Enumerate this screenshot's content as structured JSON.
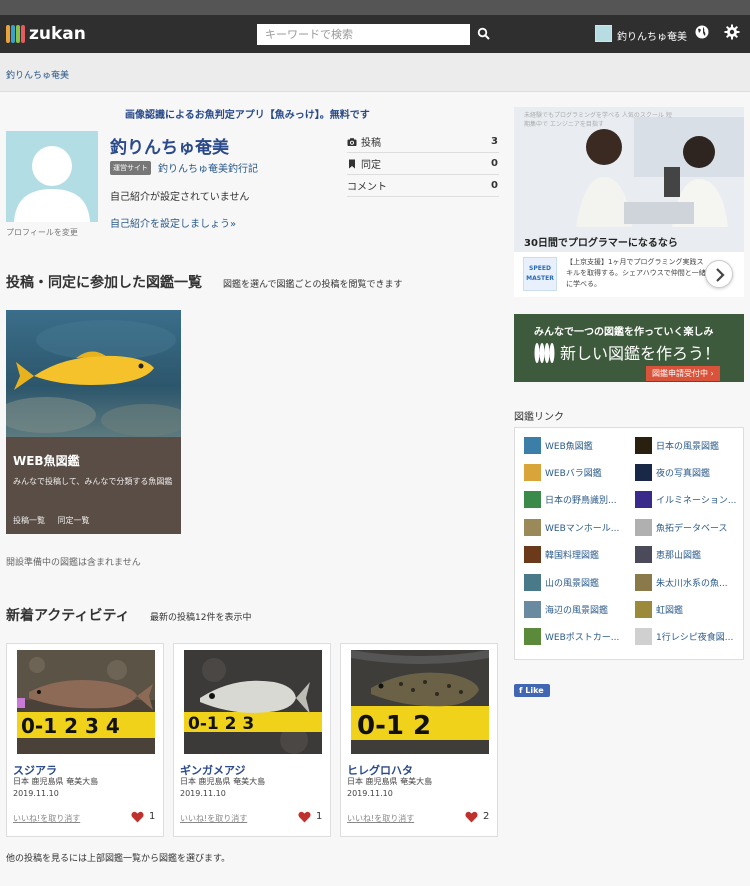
{
  "header": {
    "logo_text": "zukan",
    "search_placeholder": "キーワードで検索",
    "user_name": "釣りんちゅ奄美"
  },
  "breadcrumb": "釣りんちゅ奄美",
  "promo": "画像認識によるお魚判定アプリ【魚みっけ】。無料です",
  "profile": {
    "name": "釣りんちゅ奄美",
    "badge": "運営サイト",
    "site_link": "釣りんちゅ奄美釣行記",
    "intro": "自己紹介が設定されていません",
    "intro_link": "自己紹介を設定しましょう»",
    "change_photo": "プロフィールを変更"
  },
  "stats": [
    {
      "label": "投稿",
      "value": "3",
      "icon": "camera-icon"
    },
    {
      "label": "同定",
      "value": "0",
      "icon": "bookmark-icon"
    },
    {
      "label": "コメント",
      "value": "0",
      "icon": ""
    }
  ],
  "zukan_section": {
    "title": "投稿・同定に参加した図鑑一覧",
    "subtitle": "図鑑を選んで図鑑ごとの投稿を閲覧できます",
    "card": {
      "title": "WEB魚図鑑",
      "desc": "みんなで投稿して、みんなで分類する魚図鑑",
      "link1": "投稿一覧",
      "link2": "同定一覧"
    },
    "note": "開設準備中の図鑑は含まれません"
  },
  "activity": {
    "title": "新着アクティビティ",
    "subtitle": "最新の投稿12件を表示中",
    "items": [
      {
        "name": "スジアラ",
        "location": "日本 鹿児島県 奄美大島",
        "date": "2019.11.10",
        "like_label": "いいね!を取り消す",
        "likes": "1"
      },
      {
        "name": "ギンガメアジ",
        "location": "日本 鹿児島県 奄美大島",
        "date": "2019.11.10",
        "like_label": "いいね!を取り消す",
        "likes": "1"
      },
      {
        "name": "ヒレグロハタ",
        "location": "日本 鹿児島県 奄美大島",
        "date": "2019.11.10",
        "like_label": "いいね!を取り消す",
        "likes": "2"
      }
    ],
    "footer": "他の投稿を見るには上部図鑑一覧から図鑑を選びます。"
  },
  "ads": {
    "ad1_top": "未経験でもプログラミングを学べる 人気のスクール 短期集中で エンジニアを目指す",
    "ad1_headline": "30日間でプログラマーになるなら",
    "ad1_logo": "SPEED MASTER",
    "ad1_text": "【上京支援】1ヶ月でプログラミング実践スキルを取得する。シェアハウスで仲間と一緒に学べる。",
    "ad2_top": "みんなで一つの図鑑を作っていく楽しみ",
    "ad2_main": "新しい図鑑を作ろう！",
    "ad2_button": "図鑑申請受付中 ›"
  },
  "links": {
    "title": "図鑑リンク",
    "items": [
      {
        "label": "WEB魚図鑑",
        "color": "#3b7fa8"
      },
      {
        "label": "日本の風景図鑑",
        "color": "#2a2010"
      },
      {
        "label": "WEBバラ図鑑",
        "color": "#d9a43a"
      },
      {
        "label": "夜の写真図鑑",
        "color": "#1a2848"
      },
      {
        "label": "日本の野鳥識別...",
        "color": "#3a8a4a"
      },
      {
        "label": "イルミネーション...",
        "color": "#3a2a8a"
      },
      {
        "label": "WEBマンホール...",
        "color": "#9a8a5a"
      },
      {
        "label": "魚拓データベース",
        "color": "#b0b0b0"
      },
      {
        "label": "韓国料理図鑑",
        "color": "#6a3a1a"
      },
      {
        "label": "恵那山図鑑",
        "color": "#4a4a5a"
      },
      {
        "label": "山の風景図鑑",
        "color": "#4a7a8a"
      },
      {
        "label": "朱太川水系の魚...",
        "color": "#8a7a4a"
      },
      {
        "label": "海辺の風景図鑑",
        "color": "#6a8aa0"
      },
      {
        "label": "虹図鑑",
        "color": "#9a8a3a"
      },
      {
        "label": "WEBポストカー...",
        "color": "#5a8a3a"
      },
      {
        "label": "1行レシピ夜食図...",
        "color": "#d0d0d0"
      }
    ]
  },
  "fb_like": "Like"
}
